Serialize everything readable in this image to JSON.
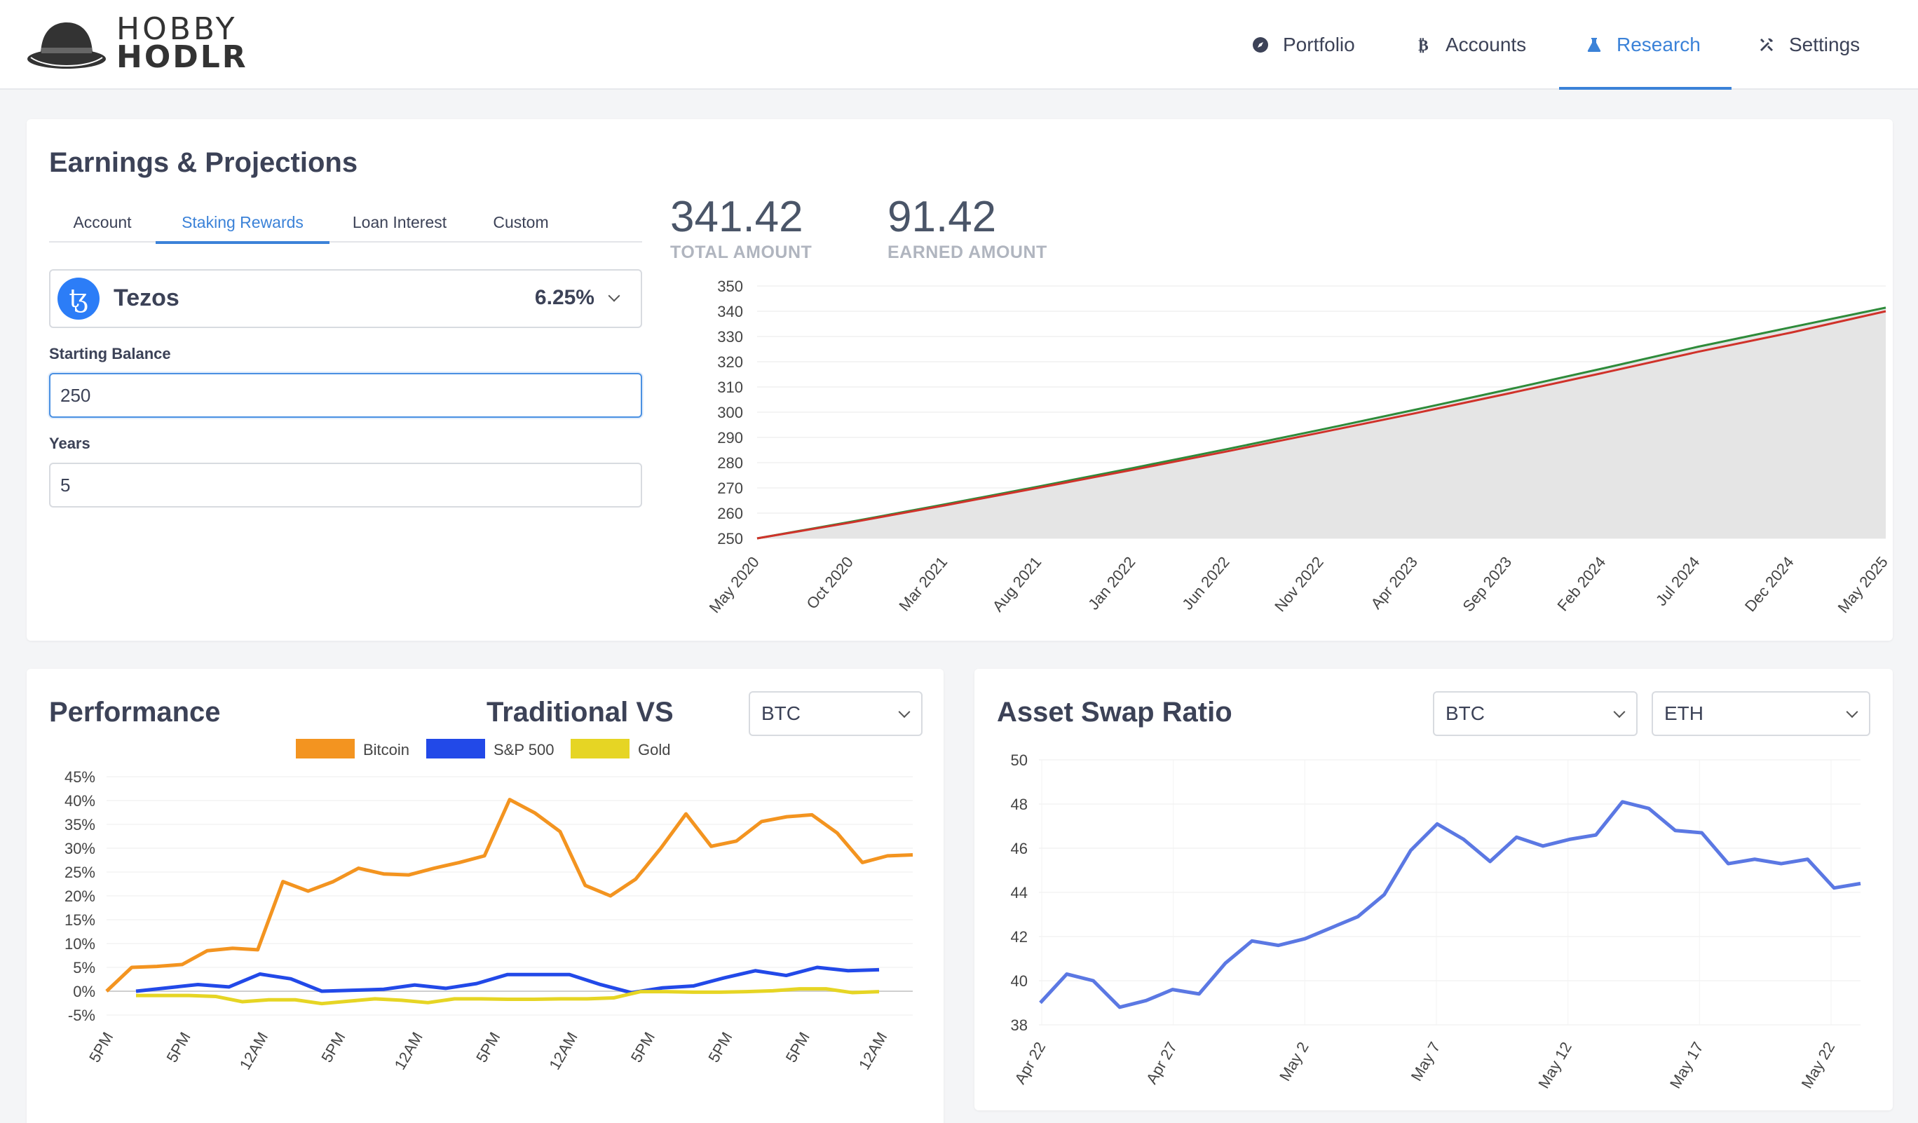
{
  "header": {
    "logo": {
      "line1": "HOBBY",
      "line2": "HODLR"
    },
    "nav": [
      {
        "label": "Portfolio",
        "icon": "compass-icon"
      },
      {
        "label": "Accounts",
        "icon": "bitcoin-icon"
      },
      {
        "label": "Research",
        "icon": "flask-icon",
        "active": true
      },
      {
        "label": "Settings",
        "icon": "tools-icon"
      }
    ]
  },
  "earnings": {
    "title": "Earnings & Projections",
    "tabs": [
      "Account",
      "Staking Rewards",
      "Loan Interest",
      "Custom"
    ],
    "active_tab": "Staking Rewards",
    "asset": {
      "name": "Tezos",
      "rate": "6.25%",
      "icon": "tezos-icon"
    },
    "starting_balance_label": "Starting Balance",
    "starting_balance": "250",
    "years_label": "Years",
    "years": "5",
    "total_amount": "341.42",
    "total_amount_label": "TOTAL AMOUNT",
    "earned_amount": "91.42",
    "earned_amount_label": "EARNED AMOUNT"
  },
  "performance": {
    "title": "Performance",
    "subtitle": "Traditional VS",
    "selected": "BTC"
  },
  "swap": {
    "title": "Asset Swap Ratio",
    "from": "BTC",
    "to": "ETH"
  },
  "chart_data": [
    {
      "type": "area",
      "ylim": [
        250,
        350
      ],
      "yticks": [
        250,
        260,
        270,
        280,
        290,
        300,
        310,
        320,
        330,
        340,
        350
      ],
      "categories": [
        "May 2020",
        "Oct 2020",
        "Mar 2021",
        "Aug 2021",
        "Jan 2022",
        "Jun 2022",
        "Nov 2022",
        "Apr 2023",
        "Sep 2023",
        "Feb 2024",
        "Jul 2024",
        "Dec 2024",
        "May 2025"
      ],
      "series": [
        {
          "color": "#2e8b3a",
          "values": [
            250,
            256.6,
            263.5,
            270.6,
            277.9,
            285.4,
            293.1,
            301.0,
            309.1,
            317.4,
            325.9,
            333.7,
            341.42
          ]
        },
        {
          "color": "#d0322a",
          "values": [
            250,
            256.3,
            263.1,
            270.1,
            277.2,
            284.5,
            292.0,
            299.6,
            307.5,
            315.6,
            323.9,
            331.6,
            340.0
          ]
        }
      ],
      "grid": true,
      "fill": "#e5e5e5"
    },
    {
      "type": "line",
      "ylim": [
        -5,
        45
      ],
      "yticks": [
        "-5%",
        "0%",
        "5%",
        "10%",
        "15%",
        "20%",
        "25%",
        "30%",
        "35%",
        "40%",
        "45%"
      ],
      "xticks": [
        "5PM",
        "5PM",
        "12AM",
        "5PM",
        "12AM",
        "5PM",
        "12AM",
        "5PM",
        "5PM",
        "5PM",
        "12AM"
      ],
      "legend": "top",
      "series": [
        {
          "name": "Bitcoin",
          "color": "#f39420",
          "values": [
            0,
            5,
            5.2,
            5.6,
            8.5,
            9.0,
            8.7,
            23,
            21,
            23,
            25.8,
            24.6,
            24.4,
            25.8,
            27,
            28.4,
            40.2,
            37.4,
            33.5,
            22.2,
            20,
            23.5,
            30,
            37.2,
            30.4,
            31.5,
            35.6,
            36.6,
            37,
            33.2,
            27,
            28.4,
            28.6
          ]
        },
        {
          "name": "S&P 500",
          "color": "#2249e8",
          "values": [
            0,
            0.7,
            1.4,
            0.9,
            3.6,
            2.6,
            0,
            0.2,
            0.4,
            1.3,
            0.6,
            1.6,
            3.5,
            3.5,
            3.5,
            1.4,
            -0.3,
            0.7,
            1.1,
            2.8,
            4.3,
            3.3,
            5.0,
            4.3,
            4.5
          ]
        },
        {
          "name": "Gold",
          "color": "#e6d524",
          "values": [
            -0.9,
            -0.9,
            -0.9,
            -1.1,
            -2.2,
            -1.8,
            -1.8,
            -2.6,
            -2.1,
            -1.6,
            -1.9,
            -2.4,
            -1.6,
            -1.6,
            -1.7,
            -1.7,
            -1.6,
            -1.6,
            -1.4,
            -0.1,
            -0.1,
            -0.2,
            -0.2,
            -0.1,
            0.1,
            0.5,
            0.5,
            -0.3,
            -0.1
          ]
        }
      ],
      "grid": true
    },
    {
      "type": "line",
      "ylim": [
        38,
        50
      ],
      "yticks": [
        38,
        40,
        42,
        44,
        46,
        48,
        50
      ],
      "xticks": [
        "Apr 22",
        "Apr 27",
        "May 2",
        "May 7",
        "May 12",
        "May 17",
        "May 22"
      ],
      "series": [
        {
          "color": "#5b78e3",
          "values": [
            39,
            40.3,
            40,
            38.8,
            39.1,
            39.6,
            39.4,
            40.8,
            41.8,
            41.6,
            41.9,
            42.4,
            42.9,
            43.9,
            45.9,
            47.1,
            46.4,
            45.4,
            46.5,
            46.1,
            46.4,
            46.6,
            48.1,
            47.8,
            46.8,
            46.7,
            45.3,
            45.5,
            45.3,
            45.5,
            44.2,
            44.4
          ]
        }
      ],
      "grid": true
    }
  ]
}
